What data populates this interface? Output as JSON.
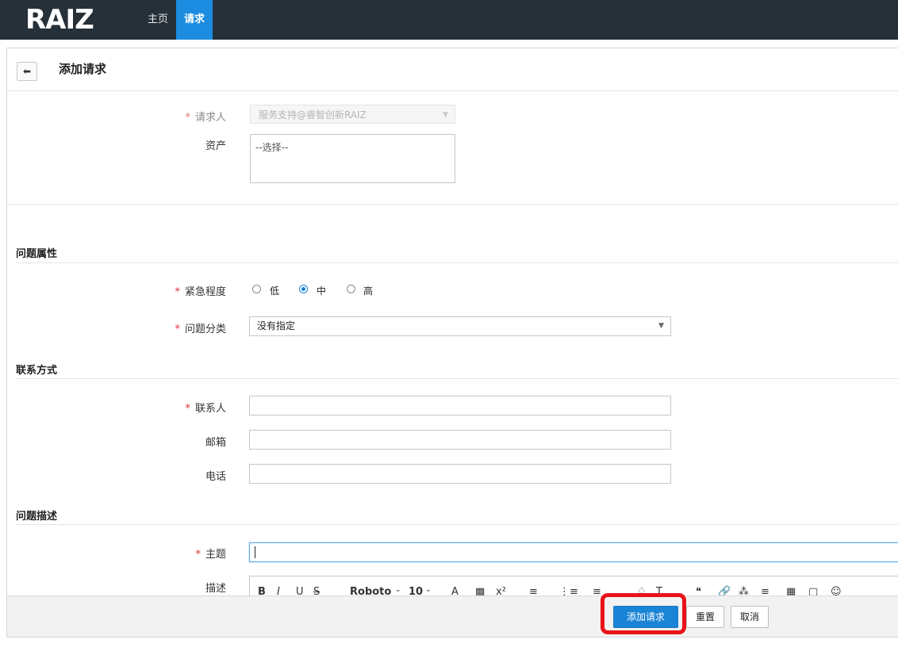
{
  "nav": {
    "logo": "RAIZ",
    "home": "主页",
    "request": "请求"
  },
  "header": {
    "back_icon": "arrow-left-icon",
    "title": "添加请求"
  },
  "requester": {
    "label": "请求人",
    "value": "服务支持@睿智创新RAIZ"
  },
  "asset": {
    "label": "资产",
    "placeholder": "--选择--"
  },
  "sections": {
    "attributes": "问题属性",
    "contact": "联系方式",
    "description": "问题描述"
  },
  "urgency": {
    "label": "紧急程度",
    "options": [
      "低",
      "中",
      "高"
    ],
    "selected": "中"
  },
  "category": {
    "label": "问题分类",
    "value": "没有指定"
  },
  "contact_fields": {
    "contact_label": "联系人",
    "email_label": "邮箱",
    "phone_label": "电话"
  },
  "subject": {
    "label": "主题",
    "value": ""
  },
  "description_field": {
    "label": "描述"
  },
  "toolbar": {
    "font": "Roboto",
    "size": "10"
  },
  "footer": {
    "submit": "添加请求",
    "reset": "重置",
    "cancel": "取消"
  },
  "colors": {
    "accent": "#1c8ce0",
    "nav_bg": "#263039",
    "highlight": "#e8141a"
  }
}
